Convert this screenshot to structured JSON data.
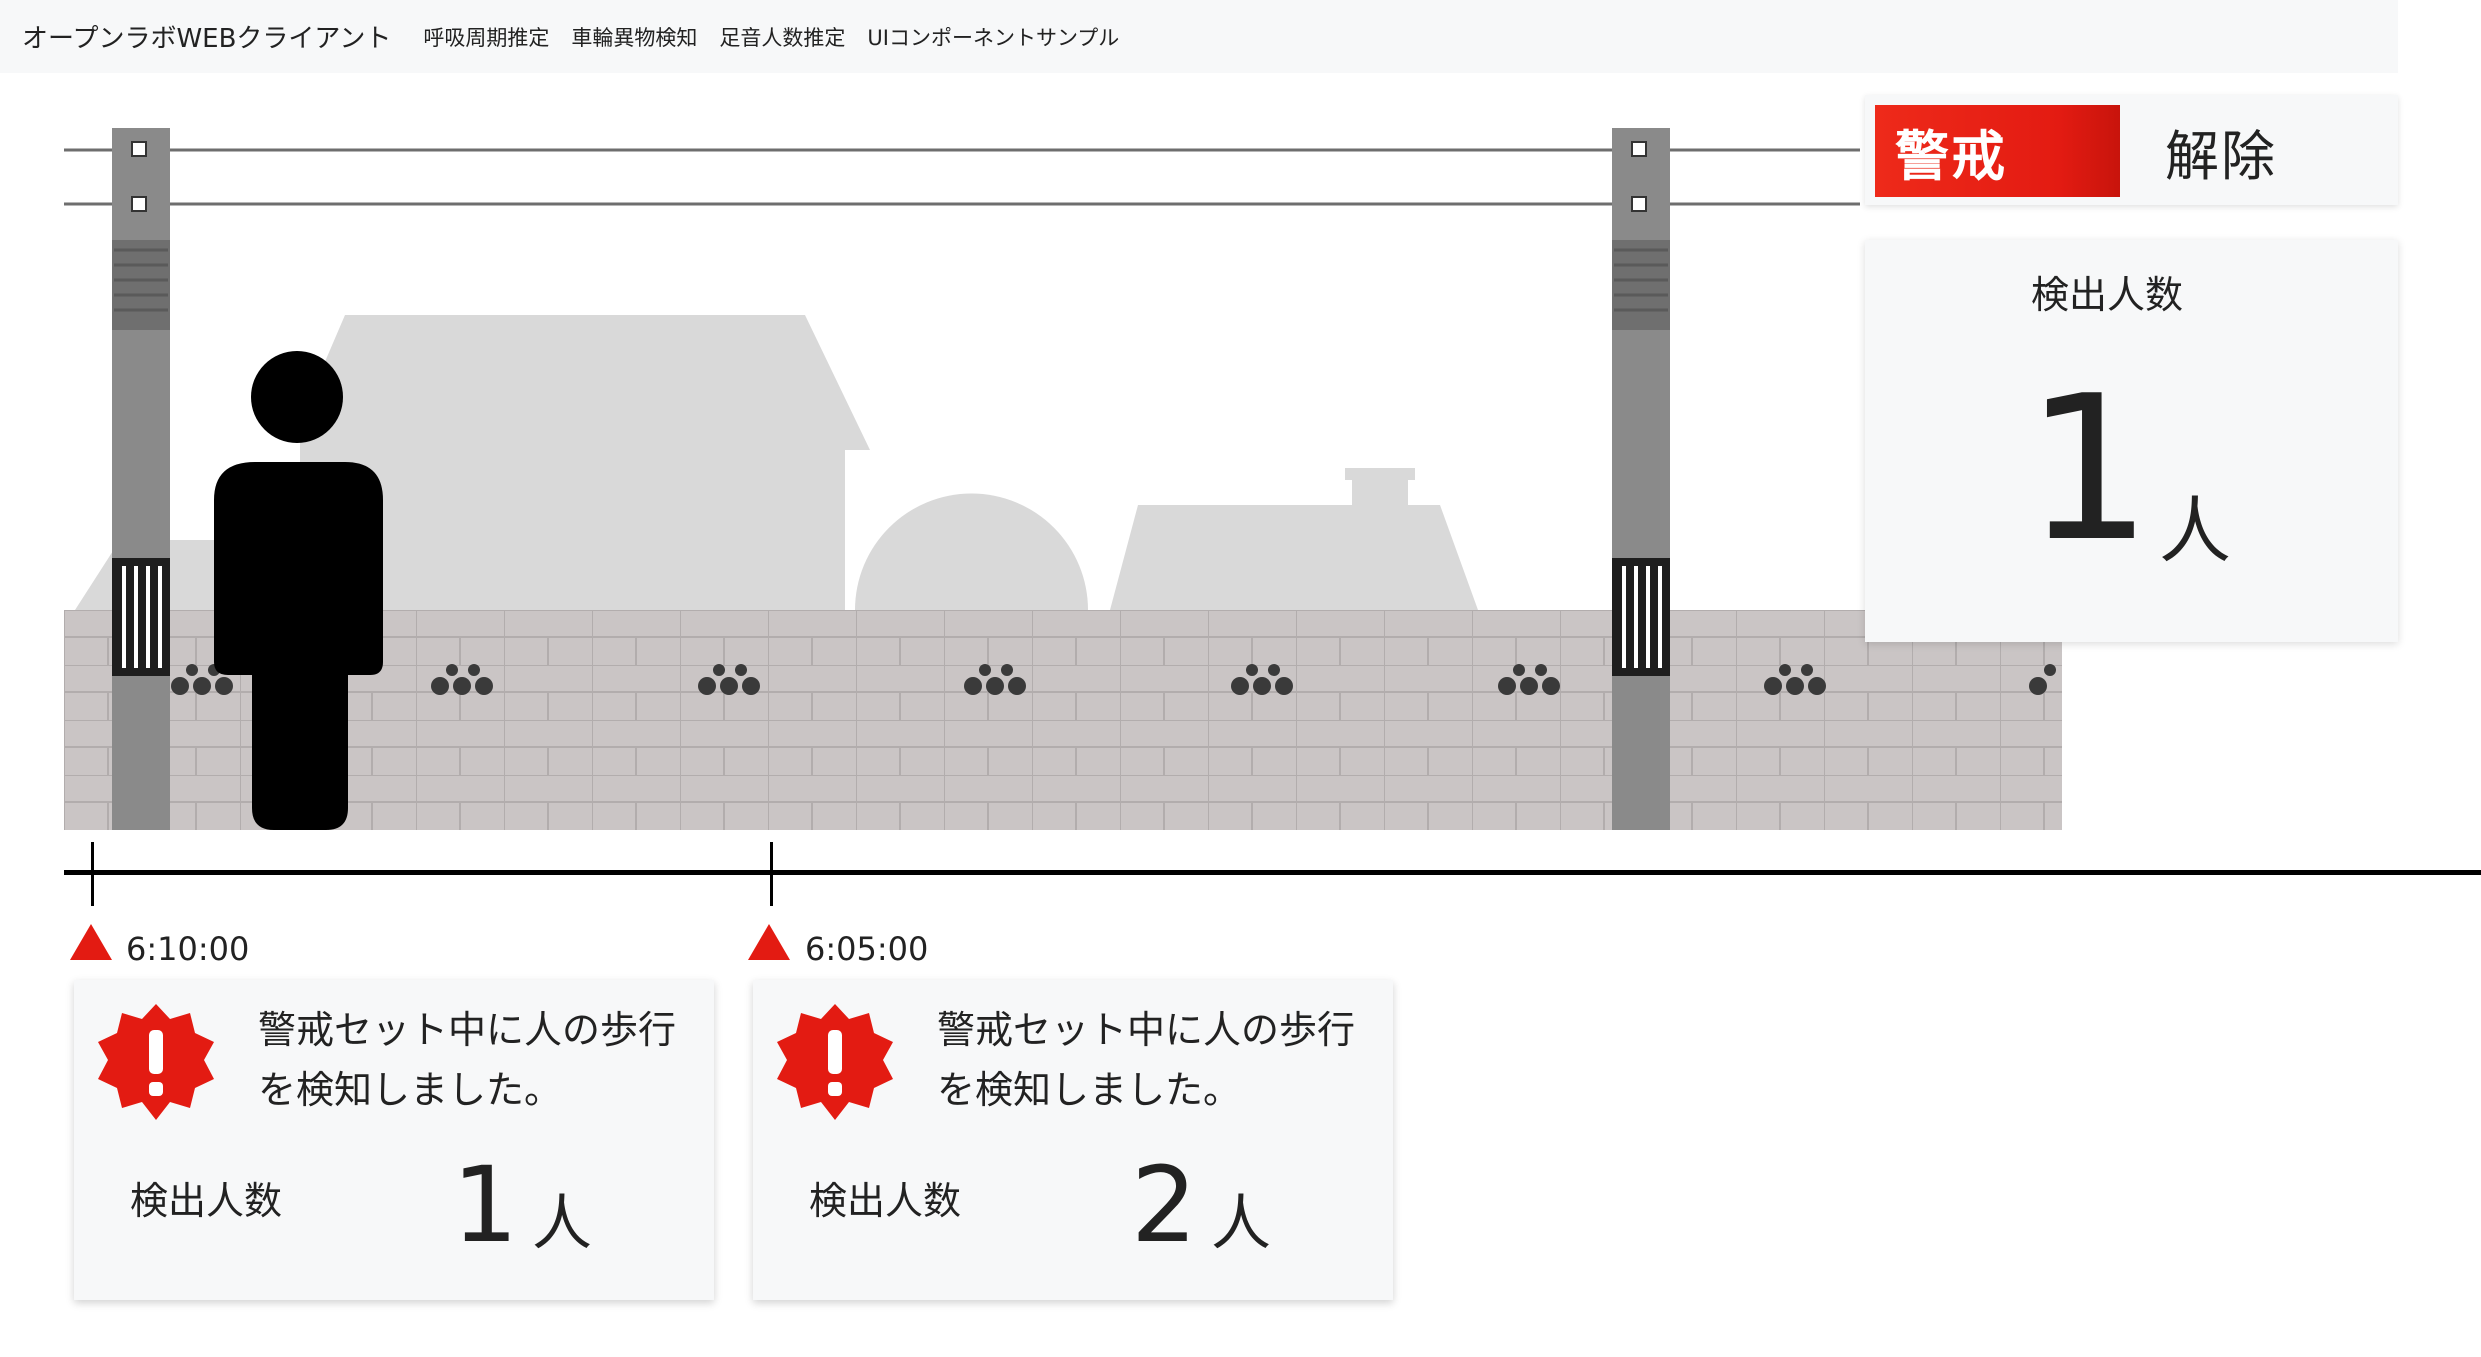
{
  "navbar": {
    "brand": "オープンラボWEBクライアント",
    "items": [
      "呼吸周期推定",
      "車輪異物検知",
      "足音人数推定",
      "UIコンポーネントサンプル"
    ]
  },
  "alert_toggle": {
    "alert_label": "警戒",
    "release_label": "解除",
    "active": "alert",
    "active_color": "#e31b12"
  },
  "count_card": {
    "label": "検出人数",
    "value": "1",
    "unit": "人"
  },
  "timeline": {
    "markers": [
      {
        "time": "6:10:00"
      },
      {
        "time": "6:05:00"
      }
    ],
    "marker_color": "#e31b12"
  },
  "events": [
    {
      "message": "警戒セット中に人の歩行を検知しました。",
      "count_label": "検出人数",
      "count": "1",
      "unit": "人",
      "icon": "alert-badge-icon"
    },
    {
      "message": "警戒セット中に人の歩行を検知しました。",
      "count_label": "検出人数",
      "count": "2",
      "unit": "人",
      "icon": "alert-badge-icon"
    }
  ]
}
